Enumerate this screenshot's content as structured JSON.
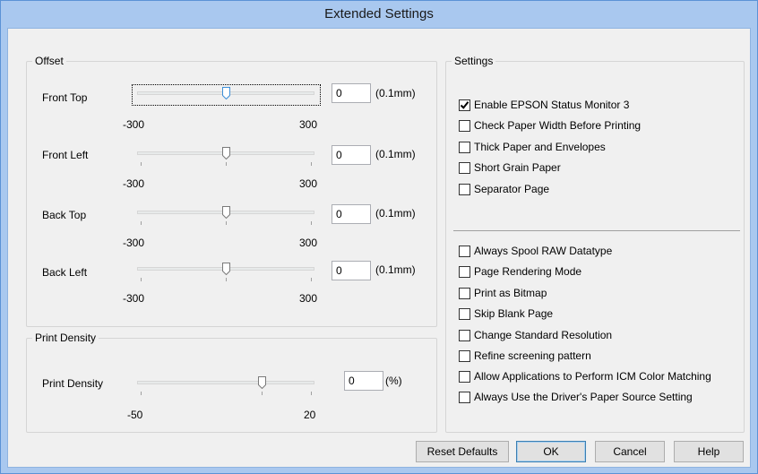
{
  "window": {
    "title": "Extended Settings"
  },
  "offset": {
    "legend": "Offset",
    "rows": [
      {
        "label": "Front Top",
        "value": "0",
        "unit": "(0.1mm)",
        "min_label": "-300",
        "max_label": "300"
      },
      {
        "label": "Front Left",
        "value": "0",
        "unit": "(0.1mm)",
        "min_label": "-300",
        "max_label": "300"
      },
      {
        "label": "Back Top",
        "value": "0",
        "unit": "(0.1mm)",
        "min_label": "-300",
        "max_label": "300"
      },
      {
        "label": "Back Left",
        "value": "0",
        "unit": "(0.1mm)",
        "min_label": "-300",
        "max_label": "300"
      }
    ]
  },
  "density": {
    "legend": "Print Density",
    "label": "Print Density",
    "value": "0",
    "unit": "(%)",
    "min_label": "-50",
    "max_label": "20"
  },
  "settings": {
    "legend": "Settings",
    "group1": [
      {
        "label": "Enable EPSON Status Monitor 3",
        "checked": true
      },
      {
        "label": "Check Paper Width Before Printing",
        "checked": false
      },
      {
        "label": "Thick Paper and Envelopes",
        "checked": false
      },
      {
        "label": "Short Grain Paper",
        "checked": false
      },
      {
        "label": "Separator Page",
        "checked": false
      }
    ],
    "group2": [
      {
        "label": "Always Spool RAW Datatype",
        "checked": false
      },
      {
        "label": "Page Rendering Mode",
        "checked": false
      },
      {
        "label": "Print as Bitmap",
        "checked": false
      },
      {
        "label": "Skip Blank Page",
        "checked": false
      },
      {
        "label": "Change Standard Resolution",
        "checked": false
      },
      {
        "label": "Refine screening pattern",
        "checked": false
      },
      {
        "label": "Allow Applications to Perform ICM Color Matching",
        "checked": false
      },
      {
        "label": "Always Use the Driver's Paper Source Setting",
        "checked": false
      }
    ]
  },
  "buttons": {
    "reset": "Reset Defaults",
    "ok": "OK",
    "cancel": "Cancel",
    "help": "Help"
  },
  "colors": {
    "title_bar": "#a9c8ef",
    "dialog_bg": "#f0f0f0",
    "focus_thumb": "#3c8fd8"
  }
}
